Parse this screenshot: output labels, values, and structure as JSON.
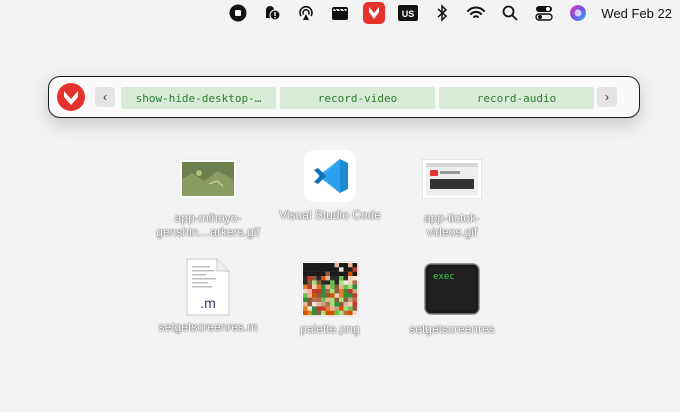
{
  "menubar": {
    "icons": [
      "stop-record-icon",
      "remote-desktop-alert-icon",
      "airdrop-icon",
      "clapper-icon",
      "raycast-app-icon",
      "keyboard-layout-icon",
      "bluetooth-icon",
      "wifi-icon",
      "spotlight-search-icon",
      "control-center-icon",
      "siri-icon"
    ],
    "keyboard_layout": "US",
    "clock": "Wed Feb 22"
  },
  "launcher": {
    "prev_label": "‹",
    "next_label": "›",
    "chips": [
      "show-hide-desktop-…",
      "record-video",
      "record-audio"
    ],
    "chip_color": "#2d7d2d",
    "chip_bg": "#d9ecd9",
    "logo_color": "#e5322d"
  },
  "desktop": {
    "items": [
      {
        "label": "app-mihoyo-\ngenshin…arkers.gif",
        "kind": "gif"
      },
      {
        "label": "Visual Studio Code",
        "kind": "app"
      },
      {
        "label": "app-tictok-\nvideos.gif",
        "kind": "gif"
      },
      {
        "label": "setgetscreenres.m",
        "kind": "matlab",
        "ext": ".m"
      },
      {
        "label": "palette.png",
        "kind": "png"
      },
      {
        "label": "setgetscreenres",
        "kind": "executable",
        "exec_text": "exec"
      }
    ]
  }
}
